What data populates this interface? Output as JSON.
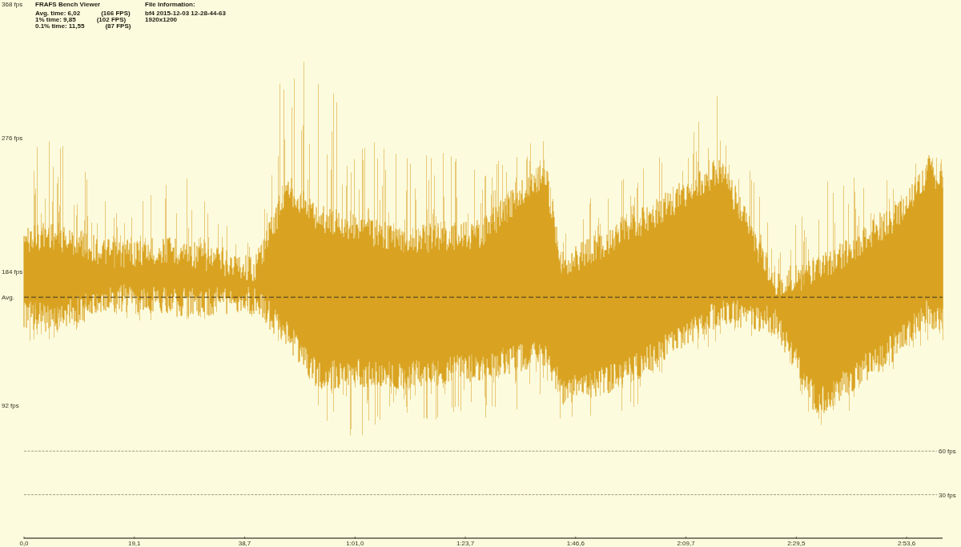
{
  "title": "FRAFS Bench Viewer",
  "stats": [
    {
      "label": "Avg. time: 6,02",
      "fps": "(166 FPS)"
    },
    {
      "label": "1% time: 9,85",
      "fps": "(102 FPS)"
    },
    {
      "label": "0.1% time: 11,55",
      "fps": "(87 FPS)"
    }
  ],
  "file_info": {
    "heading": "File Information:",
    "lines": [
      "bf4 2015-12-03 12-28-44-63",
      "1920x1200"
    ]
  },
  "chart": {
    "y_labels": [
      "368 fps",
      "276 fps",
      "184 fps",
      "92 fps"
    ],
    "avg_label": "Avg.",
    "reference_lines": [
      {
        "label": "60 fps"
      },
      {
        "label": "30 fps"
      }
    ],
    "x_labels": [
      "0,0",
      "19,1",
      "38,7",
      "1:01,0",
      "1:23,7",
      "1:46,6",
      "2:09,7",
      "2:29,5",
      "2:53,6"
    ]
  }
}
